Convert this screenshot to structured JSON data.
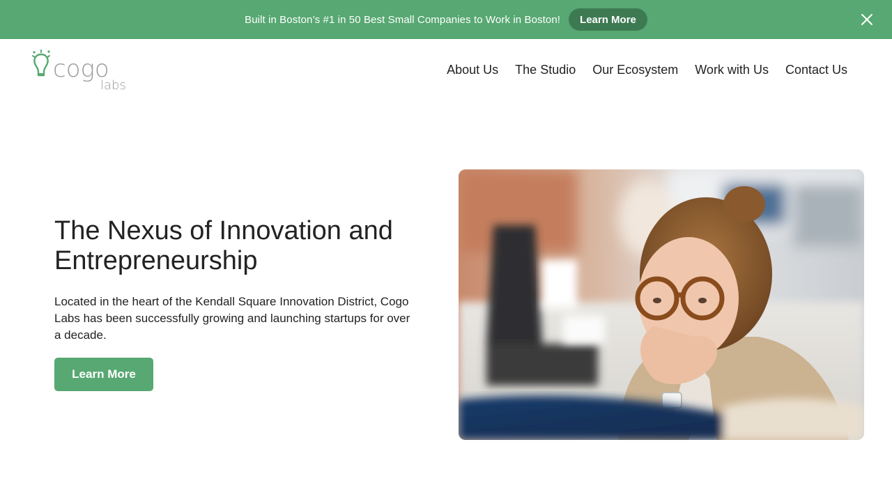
{
  "announcement": {
    "text": "Built in Boston’s #1 in 50 Best Small Companies to Work in Boston!",
    "button_label": "Learn More",
    "close_icon": "close-icon"
  },
  "header": {
    "logo": {
      "word": "cogo",
      "sub": "labs",
      "icon": "lightbulb-icon"
    },
    "nav": [
      {
        "label": "About Us"
      },
      {
        "label": "The Studio"
      },
      {
        "label": "Our Ecosystem"
      },
      {
        "label": "Work with Us"
      },
      {
        "label": "Contact Us"
      }
    ]
  },
  "hero": {
    "title": "The Nexus of Innovation and Entrepreneurship",
    "body": "Located in the heart of the Kendall Square Innovation District, Cogo Labs has been successfully growing and launching startups for over a decade.",
    "button_label": "Learn More",
    "image_alt": "Woman with glasses looking thoughtfully at a monitor in an office"
  },
  "colors": {
    "brand_green": "#57a872",
    "dark_green": "#3d7a52",
    "text": "#222222"
  }
}
